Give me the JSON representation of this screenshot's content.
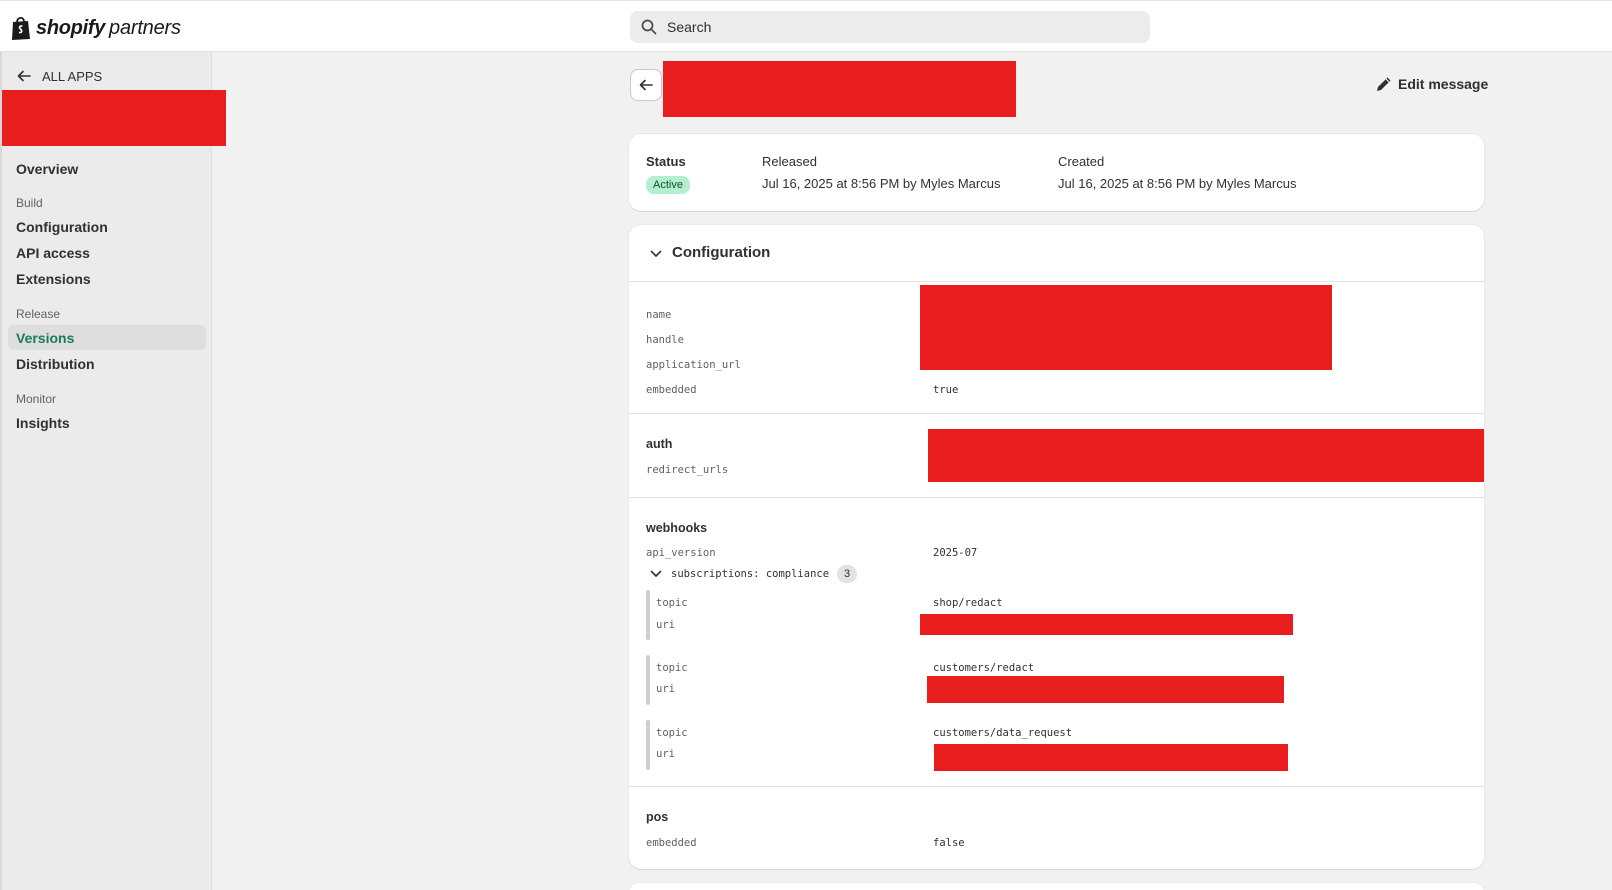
{
  "topbar": {
    "logo_word": "shopify",
    "logo_sub": "partners",
    "search_placeholder": "Search"
  },
  "sidebar": {
    "all_apps": "ALL APPS",
    "items": [
      {
        "label": "Overview"
      },
      {
        "section": "Build"
      },
      {
        "label": "Configuration"
      },
      {
        "label": "API access"
      },
      {
        "label": "Extensions"
      },
      {
        "section": "Release"
      },
      {
        "label": "Versions"
      },
      {
        "label": "Distribution"
      },
      {
        "section": "Monitor"
      },
      {
        "label": "Insights"
      }
    ],
    "active_item": "Versions"
  },
  "header": {
    "edit_message": "Edit message"
  },
  "status": {
    "status_label": "Status",
    "status_value": "Active",
    "released_label": "Released",
    "released_value": "Jul 16, 2025 at 8:56 PM by Myles Marcus",
    "created_label": "Created",
    "created_value": "Jul 16, 2025 at 8:56 PM by Myles Marcus"
  },
  "configuration": {
    "title": "Configuration",
    "general": {
      "name_key": "name",
      "handle_key": "handle",
      "application_url_key": "application_url",
      "embedded_key": "embedded",
      "embedded_value": "true"
    },
    "auth": {
      "title": "auth",
      "redirect_urls_key": "redirect_urls"
    },
    "webhooks": {
      "title": "webhooks",
      "api_version_key": "api_version",
      "api_version_value": "2025-07",
      "subscriptions_label": "subscriptions: compliance",
      "subscriptions_count": "3",
      "subscriptions": [
        {
          "topic_key": "topic",
          "topic_value": "shop/redact",
          "uri_key": "uri"
        },
        {
          "topic_key": "topic",
          "topic_value": "customers/redact",
          "uri_key": "uri"
        },
        {
          "topic_key": "topic",
          "topic_value": "customers/data_request",
          "uri_key": "uri"
        }
      ]
    },
    "pos": {
      "title": "pos",
      "embedded_key": "embedded",
      "embedded_value": "false"
    }
  },
  "colors": {
    "accent_active_nav": "#1a7a5a",
    "badge_bg": "#b4f0d0",
    "redaction": "#e81d1d"
  }
}
